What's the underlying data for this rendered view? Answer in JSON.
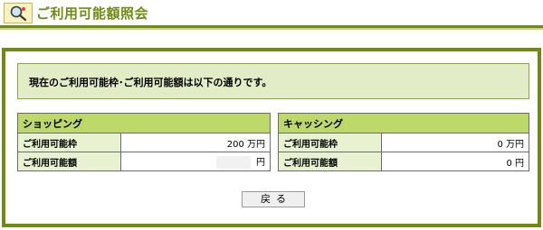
{
  "header": {
    "title": "ご利用可能額照会",
    "icon": "magnifier-search-icon"
  },
  "notice": "現在のご利用可能枠･ご利用可能額は以下の通りです。",
  "shopping": {
    "title": "ショッピング",
    "limit_label": "ご利用可能枠",
    "limit_value": "200 万円",
    "available_label": "ご利用可能額",
    "available_value": "円"
  },
  "cashing": {
    "title": "キャッシング",
    "limit_label": "ご利用可能枠",
    "limit_value": "0 万円",
    "available_label": "ご利用可能額",
    "available_value": "0 円"
  },
  "actions": {
    "back_label": "戻る"
  },
  "colors": {
    "accent": "#6f8c12",
    "header_bg": "#bdd96a",
    "label_bg": "#e9f2d0",
    "notice_bg": "#e2ecc6"
  }
}
